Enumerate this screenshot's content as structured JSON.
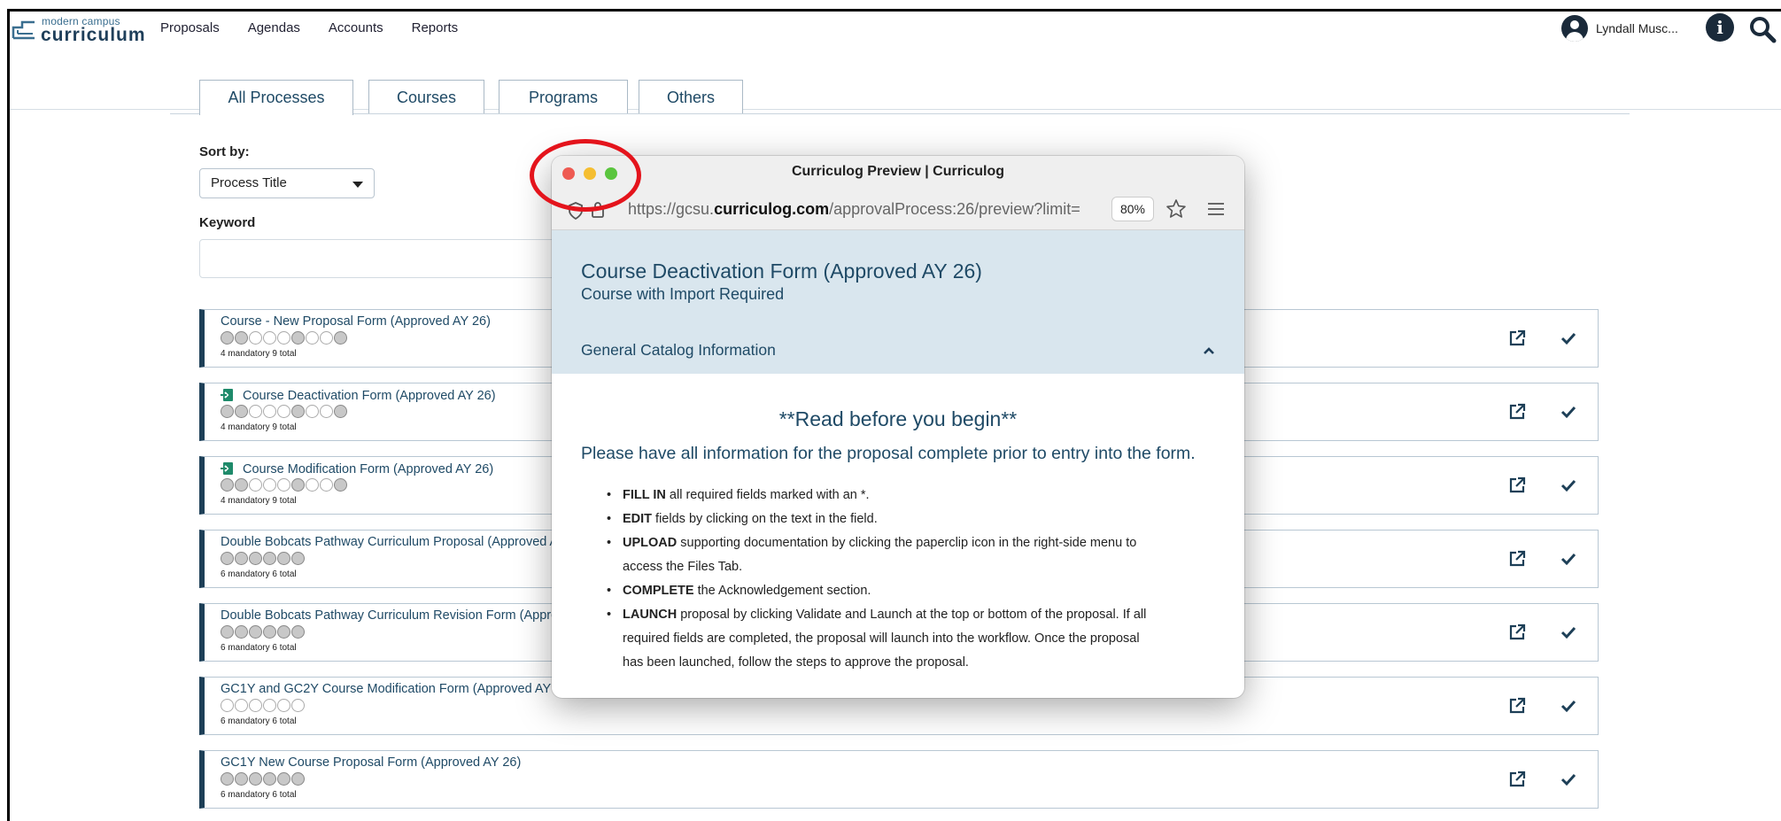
{
  "logo": {
    "small": "modern campus",
    "big": "curriculum"
  },
  "nav": [
    "Proposals",
    "Agendas",
    "Accounts",
    "Reports"
  ],
  "user": {
    "name": "Lyndall Musc..."
  },
  "tabs": [
    {
      "label": "All Processes",
      "active": true
    },
    {
      "label": "Courses",
      "active": false
    },
    {
      "label": "Programs",
      "active": false
    },
    {
      "label": "Others",
      "active": false
    }
  ],
  "sort": {
    "label": "Sort by:",
    "value": "Process Title"
  },
  "keyword": {
    "label": "Keyword",
    "value": ""
  },
  "processes": [
    {
      "title": "Course - New Proposal Form (Approved AY 26)",
      "doc_icon": false,
      "circles": "ffeeefee f",
      "meta": "4 mandatory 9 total"
    },
    {
      "title": "Course Deactivation Form (Approved AY 26)",
      "doc_icon": true,
      "circles": "ffeeefeef",
      "meta": "4 mandatory 9 total"
    },
    {
      "title": "Course Modification Form (Approved AY 26)",
      "doc_icon": true,
      "circles": "ffeeefeef",
      "meta": "4 mandatory 9 total"
    },
    {
      "title": "Double Bobcats Pathway Curriculum Proposal (Approved A",
      "doc_icon": false,
      "circles": "ffffff",
      "meta": "6 mandatory 6 total"
    },
    {
      "title": "Double Bobcats Pathway Curriculum Revision Form (Appro",
      "doc_icon": false,
      "circles": "ffffff",
      "meta": "6 mandatory 6 total"
    },
    {
      "title": "GC1Y and GC2Y Course Modification Form (Approved AY 2",
      "doc_icon": false,
      "circles": "eeeeee",
      "meta": "6 mandatory 6 total"
    },
    {
      "title": "GC1Y New Course Proposal Form (Approved AY 26)",
      "doc_icon": false,
      "circles": "ffffff",
      "meta": "6 mandatory 6 total"
    }
  ],
  "preview": {
    "window_title": "Curriculog Preview | Curriculog",
    "url_prefix": "https://gcsu.",
    "url_domain": "curriculog.com",
    "url_rest": "/approvalProcess:26/preview?limit=",
    "zoom": "80%",
    "form_title": "Course Deactivation Form (Approved AY 26)",
    "form_subtitle": "Course with Import Required",
    "section": "General Catalog Information",
    "read_title": "**Read before you begin**",
    "lead": "Please have all information for the proposal complete prior to entry into the form.",
    "bullets": [
      {
        "bold": "FILL IN",
        "text": " all required fields marked with an *."
      },
      {
        "bold": "EDIT",
        "text": " fields by clicking on the text in the field."
      },
      {
        "bold": "UPLOAD",
        "text": " supporting documentation by clicking the paperclip icon in the right-side menu to access the Files Tab."
      },
      {
        "bold": "COMPLETE",
        "text": " the Acknowledgement section."
      },
      {
        "bold": "LAUNCH",
        "text": " proposal by clicking Validate and Launch at the top or bottom of the proposal.  If all required fields are completed, the proposal will launch into the workflow. Once the proposal has been launched, follow the steps to approve the proposal."
      }
    ]
  },
  "colors": {
    "accent": "#1f4a66",
    "bar": "#1d3f57",
    "annotation": "#e4141c"
  }
}
